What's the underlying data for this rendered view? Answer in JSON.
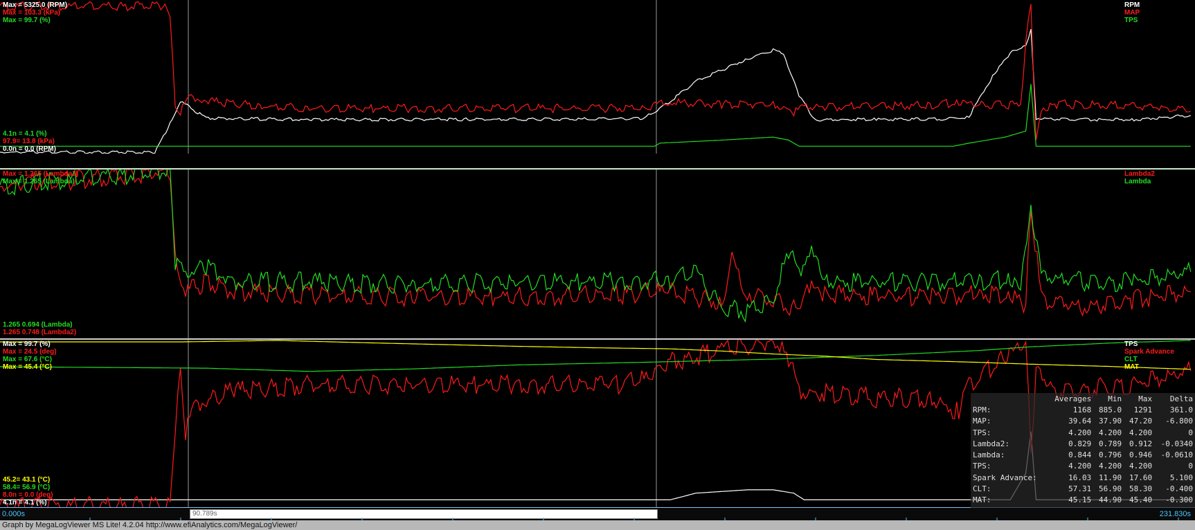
{
  "colors": {
    "rpm": "#ffffff",
    "map": "#ff1a1a",
    "tps": "#22dd22",
    "lambda2": "#ff1a1a",
    "lambda": "#22dd22",
    "tps2": "#ffffff",
    "spark": "#ff1a1a",
    "clt": "#22dd22",
    "mat": "#ffff00",
    "cursor": "#9a9a9a",
    "border": "#9ad0ff"
  },
  "panel1": {
    "top_left": [
      "Max = 5325.0 (RPM)",
      "Max = 103.3 (kPa)",
      "Max = 99.7 (%)"
    ],
    "bottom_left": [
      "4.1n = 4.1 (%)",
      "97.9= 13.8 (kPa)",
      "0.0n = 0.0 (RPM)"
    ],
    "legend": [
      "RPM",
      "MAP",
      "TPS"
    ]
  },
  "panel2": {
    "top_left": [
      "Max = 1.265 (Lambda2)",
      "Max = 1.265 (Lambda)"
    ],
    "bottom_left": [
      "1.265 0.694 (Lambda)",
      "1.265 0.748 (Lambda2)"
    ],
    "legend": [
      "Lambda2",
      "Lambda"
    ]
  },
  "panel3": {
    "top_left": [
      "Max = 99.7 (%)",
      "Max = 24.5 (deg)",
      "Max = 67.6 (°C)",
      "Max = 45.4 (°C)"
    ],
    "bottom_left": [
      "45.2= 43.1 (°C)",
      "58.4= 56.9 (°C)",
      "8.0n = 0.0 (deg)",
      "4.1n = 4.1 (%)"
    ],
    "legend": [
      "TPS",
      "Spark Advance",
      "CLT",
      "MAT"
    ]
  },
  "stats": {
    "headers": [
      "",
      "Averages",
      "Min",
      "Max",
      "Delta"
    ],
    "rows": [
      [
        "RPM:",
        "1168",
        "885.0",
        "1291",
        "361.0"
      ],
      [
        "MAP:",
        "39.64",
        "37.90",
        "47.20",
        "-6.800"
      ],
      [
        "TPS:",
        "4.200",
        "4.200",
        "4.200",
        "0"
      ],
      [
        "Lambda2:",
        "0.829",
        "0.789",
        "0.912",
        "-0.0340"
      ],
      [
        "Lambda:",
        "0.844",
        "0.796",
        "0.946",
        "-0.0610"
      ],
      [
        "TPS:",
        "4.200",
        "4.200",
        "4.200",
        "0"
      ],
      [
        "Spark Advance:",
        "16.03",
        "11.90",
        "17.60",
        "5.100"
      ],
      [
        "CLT:",
        "57.31",
        "56.90",
        "58.30",
        "-0.400"
      ],
      [
        "MAT:",
        "45.15",
        "44.90",
        "45.40",
        "-0.300"
      ]
    ]
  },
  "timebar": {
    "start": "0.000s",
    "selection": "90.789s",
    "end": "231.830s"
  },
  "footer": "Graph by MegaLogViewer MS Lite! 4.2.04 http://www.efiAnalytics.com/MegaLogViewer/",
  "chart_data": [
    {
      "type": "line",
      "x_label": "",
      "x_range": [
        0,
        231.83
      ],
      "series": [
        {
          "name": "RPM",
          "ylim": [
            0,
            5325
          ],
          "points": [
            [
              0,
              0
            ],
            [
              30,
              0
            ],
            [
              33,
              1000
            ],
            [
              35,
              1800
            ],
            [
              40,
              1200
            ],
            [
              60,
              1150
            ],
            [
              90,
              1160
            ],
            [
              115,
              1170
            ],
            [
              125,
              1200
            ],
            [
              130,
              1800
            ],
            [
              135,
              2500
            ],
            [
              145,
              3300
            ],
            [
              150,
              3600
            ],
            [
              152,
              3500
            ],
            [
              155,
              2000
            ],
            [
              158,
              1150
            ],
            [
              170,
              1160
            ],
            [
              185,
              1180
            ],
            [
              188,
              1250
            ],
            [
              190,
              1900
            ],
            [
              193,
              2800
            ],
            [
              196,
              3500
            ],
            [
              199,
              3800
            ],
            [
              200,
              4300
            ],
            [
              201,
              1200
            ],
            [
              210,
              1150
            ],
            [
              220,
              1150
            ],
            [
              231,
              1300
            ]
          ]
        },
        {
          "name": "MAP",
          "ylim": [
            0,
            103.3
          ],
          "points": [
            [
              0,
              100
            ],
            [
              32,
              100
            ],
            [
              33,
              95
            ],
            [
              34,
              30
            ],
            [
              35,
              28
            ],
            [
              37,
              38
            ],
            [
              40,
              35
            ],
            [
              50,
              32
            ],
            [
              60,
              30
            ],
            [
              80,
              30
            ],
            [
              100,
              30
            ],
            [
              115,
              30
            ],
            [
              125,
              31
            ],
            [
              127,
              32
            ],
            [
              130,
              34
            ],
            [
              140,
              33
            ],
            [
              150,
              33
            ],
            [
              154,
              28
            ],
            [
              156,
              31
            ],
            [
              160,
              31
            ],
            [
              180,
              32
            ],
            [
              186,
              34
            ],
            [
              190,
              32
            ],
            [
              198,
              33
            ],
            [
              199,
              75
            ],
            [
              200,
              103
            ],
            [
              201,
              6
            ],
            [
              202,
              30
            ],
            [
              205,
              33
            ],
            [
              220,
              32
            ],
            [
              231,
              28
            ]
          ]
        },
        {
          "name": "TPS",
          "ylim": [
            0,
            99.7
          ],
          "points": [
            [
              0,
              4
            ],
            [
              127,
              4
            ],
            [
              128,
              6
            ],
            [
              140,
              8
            ],
            [
              150,
              10
            ],
            [
              153,
              8
            ],
            [
              155,
              4
            ],
            [
              185,
              4
            ],
            [
              188,
              6
            ],
            [
              195,
              10
            ],
            [
              199,
              14
            ],
            [
              200,
              45
            ],
            [
              201,
              4
            ],
            [
              231,
              4
            ]
          ]
        }
      ]
    },
    {
      "type": "line",
      "x_range": [
        0,
        231.83
      ],
      "series": [
        {
          "name": "Lambda2",
          "ylim": [
            0.6,
            1.265
          ],
          "points": [
            [
              0,
              1.2
            ],
            [
              33,
              1.26
            ],
            [
              34,
              0.9
            ],
            [
              36,
              0.78
            ],
            [
              40,
              0.82
            ],
            [
              45,
              0.78
            ],
            [
              60,
              0.77
            ],
            [
              80,
              0.76
            ],
            [
              100,
              0.76
            ],
            [
              120,
              0.77
            ],
            [
              130,
              0.78
            ],
            [
              140,
              0.74
            ],
            [
              142,
              0.9
            ],
            [
              145,
              0.78
            ],
            [
              150,
              0.74
            ],
            [
              154,
              0.72
            ],
            [
              157,
              0.8
            ],
            [
              160,
              0.77
            ],
            [
              180,
              0.76
            ],
            [
              190,
              0.77
            ],
            [
              196,
              0.77
            ],
            [
              199,
              0.72
            ],
            [
              200,
              1.13
            ],
            [
              202,
              0.75
            ],
            [
              210,
              0.72
            ],
            [
              220,
              0.75
            ],
            [
              231,
              0.78
            ]
          ]
        },
        {
          "name": "Lambda",
          "ylim": [
            0.6,
            1.265
          ],
          "points": [
            [
              0,
              1.2
            ],
            [
              33,
              1.265
            ],
            [
              34,
              0.9
            ],
            [
              36,
              0.85
            ],
            [
              40,
              0.88
            ],
            [
              45,
              0.82
            ],
            [
              60,
              0.82
            ],
            [
              80,
              0.81
            ],
            [
              100,
              0.82
            ],
            [
              120,
              0.82
            ],
            [
              130,
              0.83
            ],
            [
              135,
              0.85
            ],
            [
              140,
              0.72
            ],
            [
              145,
              0.7
            ],
            [
              150,
              0.74
            ],
            [
              153,
              0.95
            ],
            [
              155,
              0.85
            ],
            [
              157,
              0.96
            ],
            [
              160,
              0.82
            ],
            [
              180,
              0.82
            ],
            [
              190,
              0.82
            ],
            [
              196,
              0.83
            ],
            [
              198,
              0.78
            ],
            [
              200,
              1.13
            ],
            [
              202,
              0.84
            ],
            [
              210,
              0.82
            ],
            [
              220,
              0.82
            ],
            [
              231,
              0.86
            ]
          ]
        }
      ]
    },
    {
      "type": "line",
      "x_range": [
        0,
        231.83
      ],
      "series": [
        {
          "name": "TPS",
          "ylim": [
            0,
            99.7
          ],
          "points": [
            [
              0,
              4
            ],
            [
              130,
              4
            ],
            [
              135,
              8
            ],
            [
              145,
              10
            ],
            [
              150,
              10
            ],
            [
              154,
              8
            ],
            [
              156,
              4
            ],
            [
              196,
              4
            ],
            [
              199,
              20
            ],
            [
              200,
              45
            ],
            [
              201,
              4
            ],
            [
              231,
              4
            ]
          ]
        },
        {
          "name": "Spark Advance",
          "ylim": [
            0,
            24.5
          ],
          "points": [
            [
              0,
              0
            ],
            [
              33,
              0
            ],
            [
              34,
              12
            ],
            [
              35,
              20
            ],
            [
              36,
              11
            ],
            [
              38,
              15
            ],
            [
              45,
              17
            ],
            [
              60,
              18
            ],
            [
              80,
              18
            ],
            [
              100,
              18
            ],
            [
              120,
              18
            ],
            [
              127,
              19
            ],
            [
              128,
              21
            ],
            [
              140,
              23
            ],
            [
              150,
              24.5
            ],
            [
              153,
              22
            ],
            [
              155,
              17
            ],
            [
              170,
              16
            ],
            [
              180,
              16
            ],
            [
              186,
              14
            ],
            [
              188,
              18
            ],
            [
              195,
              22
            ],
            [
              199,
              24
            ],
            [
              200,
              8
            ],
            [
              201,
              20
            ],
            [
              205,
              17
            ],
            [
              220,
              18
            ],
            [
              231,
              20
            ]
          ]
        },
        {
          "name": "CLT",
          "ylim": [
            0,
            67.6
          ],
          "points": [
            [
              0,
              56.9
            ],
            [
              40,
              56.3
            ],
            [
              60,
              55
            ],
            [
              80,
              56
            ],
            [
              100,
              57.6
            ],
            [
              127,
              58.8
            ],
            [
              150,
              60
            ],
            [
              170,
              61.5
            ],
            [
              190,
              63.5
            ],
            [
              200,
              65
            ],
            [
              215,
              66.5
            ],
            [
              231,
              67.6
            ]
          ]
        },
        {
          "name": "MAT",
          "ylim": [
            0,
            45.4
          ],
          "points": [
            [
              0,
              45
            ],
            [
              35,
              45
            ],
            [
              54,
              45.4
            ],
            [
              70,
              44.8
            ],
            [
              85,
              44.3
            ],
            [
              100,
              43.8
            ],
            [
              115,
              43.4
            ],
            [
              130,
              43.1
            ],
            [
              140,
              42.5
            ],
            [
              150,
              41.7
            ],
            [
              160,
              41.1
            ],
            [
              170,
              40.2
            ],
            [
              180,
              39.8
            ],
            [
              190,
              39.4
            ],
            [
              200,
              38.9
            ],
            [
              215,
              38.3
            ],
            [
              231,
              37.5
            ]
          ]
        }
      ]
    }
  ]
}
